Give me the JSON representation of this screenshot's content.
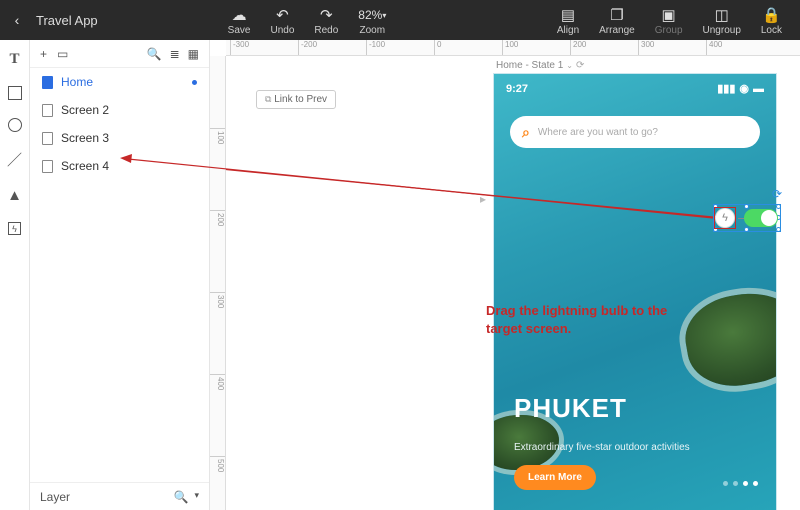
{
  "app": {
    "title": "Travel App"
  },
  "toolbar": {
    "save": "Save",
    "undo": "Undo",
    "redo": "Redo",
    "zoom_value": "82%",
    "zoom_label": "Zoom",
    "align": "Align",
    "arrange": "Arrange",
    "group": "Group",
    "ungroup": "Ungroup",
    "lock": "Lock"
  },
  "panel": {
    "footer_label": "Layer",
    "screens": [
      {
        "name": "Home",
        "active": true
      },
      {
        "name": "Screen 2",
        "active": false
      },
      {
        "name": "Screen 3",
        "active": false
      },
      {
        "name": "Screen 4",
        "active": false
      }
    ]
  },
  "canvas": {
    "link_prev": "Link to Prev",
    "artboard_label": "Home - State 1",
    "ruler_h": [
      "-300",
      "-200",
      "-100",
      "0",
      "100",
      "200",
      "300",
      "400"
    ],
    "ruler_v": [
      "100",
      "200",
      "300",
      "400",
      "500"
    ]
  },
  "mock": {
    "time": "9:27",
    "search_placeholder": "Where are you want to go?",
    "title": "PHUKET",
    "subtitle": "Extraordinary five-star outdoor activities",
    "cta": "Learn More"
  },
  "annotation": {
    "text": "Drag the lightning bulb to the target screen."
  }
}
